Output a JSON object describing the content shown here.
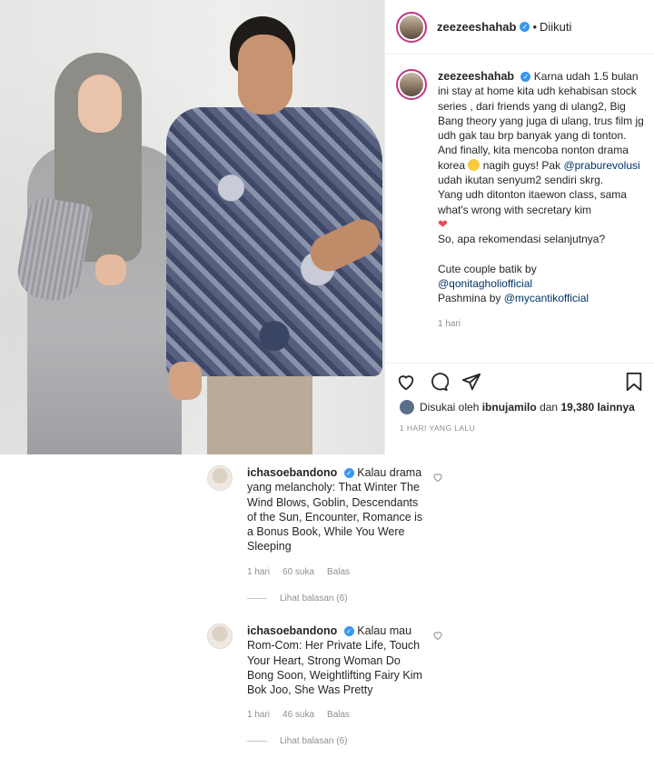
{
  "post": {
    "username": "zeezeeshahab",
    "verified_glyph": "✓",
    "separator": "•",
    "follow_status": "Diikuti",
    "caption": {
      "username": "zeezeeshahab",
      "p1": "Karna udah 1.5 bulan ini stay at home kita udh kehabisan stock series , dari friends yang di ulang2, Big Bang theory yang juga di ulang, trus film jg udh gak tau brp banyak yang di tonton.",
      "p2a": "And finally, kita mencoba nonton drama korea",
      "p2b": "nagih guys! Pak",
      "mention1": "@praburevolusi",
      "p2c": "udah ikutan senyum2 sendiri skrg.",
      "p3": "Yang udh ditonton itaewon class, sama what's wrong with secretary kim",
      "heart": "❤",
      "p4": "So, apa rekomendasi selanjutnya?",
      "credit1_label": "Cute couple batik by",
      "mention2": "@qonitagholiofficial",
      "credit2_label": "Pashmina by",
      "mention3": "@mycantikofficial",
      "time": "1 hari"
    },
    "likes": {
      "prefix": "Disukai oleh",
      "user": "ibnujamilo",
      "middle": "dan",
      "count": "19,380 lainnya"
    },
    "date": "1 HARI YANG LALU"
  },
  "comments": [
    {
      "username": "ichasoebandono",
      "text": "Kalau drama yang melancholy: That Winter The Wind Blows, Goblin, Descendants of the Sun, Encounter, Romance is a Bonus Book, While You Were Sleeping",
      "time": "1 hari",
      "likes": "60 suka",
      "reply": "Balas",
      "view_replies": "Lihat balasan (6)"
    },
    {
      "username": "ichasoebandono",
      "text": "Kalau mau Rom-Com: Her Private Life, Touch Your Heart, Strong Woman Do Bong Soon, Weightlifting Fairy Kim Bok Joo, She Was Pretty",
      "time": "1 hari",
      "likes": "46 suka",
      "reply": "Balas",
      "view_replies": "Lihat balasan (6)"
    }
  ],
  "icons": {
    "like": "heart-icon",
    "comment": "comment-icon",
    "share": "share-icon",
    "save": "bookmark-icon"
  },
  "colors": {
    "verified": "#3897f0",
    "link": "#003569",
    "muted": "#8e8e8e",
    "heart": "#ed4956"
  }
}
